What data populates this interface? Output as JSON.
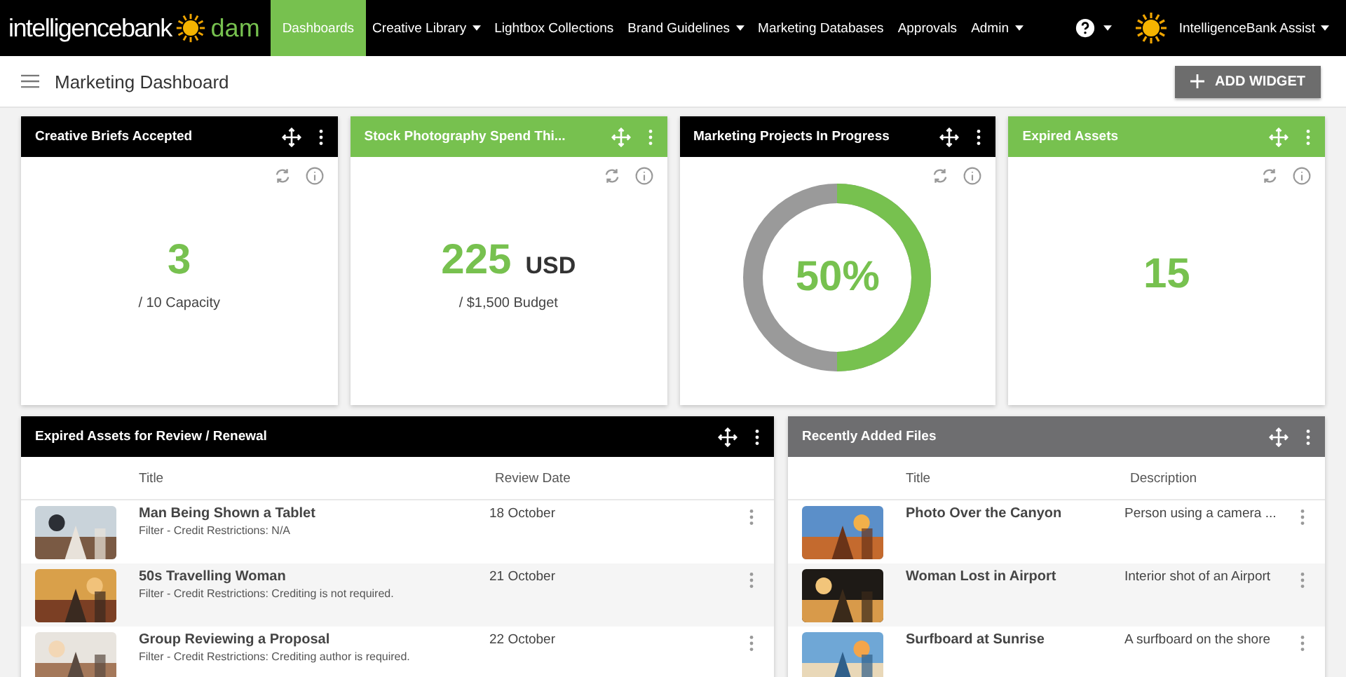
{
  "brand": {
    "name": "intelligencebank",
    "product": "dam"
  },
  "nav": [
    {
      "label": "Dashboards",
      "selected": true,
      "dropdown": false
    },
    {
      "label": "Creative Library",
      "selected": false,
      "dropdown": true
    },
    {
      "label": "Lightbox Collections",
      "selected": false,
      "dropdown": false
    },
    {
      "label": "Brand Guidelines",
      "selected": false,
      "dropdown": true
    },
    {
      "label": "Marketing Databases",
      "selected": false,
      "dropdown": false
    },
    {
      "label": "Approvals",
      "selected": false,
      "dropdown": false
    },
    {
      "label": "Admin",
      "selected": false,
      "dropdown": true
    }
  ],
  "user": {
    "name": "IntelligenceBank Assist"
  },
  "page": {
    "title": "Marketing Dashboard",
    "add_button": "ADD WIDGET"
  },
  "widgets": [
    {
      "title": "Creative Briefs Accepted",
      "color": "#000000",
      "kind": "stat",
      "value": "3",
      "caption": "/ 10 Capacity"
    },
    {
      "title": "Stock Photography Spend Thi...",
      "color": "#77c14f",
      "kind": "stat",
      "value": "225",
      "unit": "USD",
      "caption": "/ $1,500 Budget"
    },
    {
      "title": "Marketing Projects In Progress",
      "color": "#000000",
      "kind": "donut",
      "value": "50%",
      "level": 0.5
    },
    {
      "title": "Expired Assets",
      "color": "#77c14f",
      "kind": "stat",
      "value": "15"
    }
  ],
  "tables": [
    {
      "title": "Expired Assets for Review / Renewal",
      "color": "#000000",
      "columns": [
        "Title",
        "Review Date"
      ],
      "rows": [
        {
          "title": "Man Being Shown a Tablet",
          "subtitle": "Filter - Credit Restrictions: N/A",
          "cell": "18 October"
        },
        {
          "title": "50s Travelling Woman",
          "subtitle": "Filter - Credit Restrictions: Crediting is not required.",
          "cell": "21 October"
        },
        {
          "title": "Group Reviewing a Proposal",
          "subtitle": "Filter - Credit Restrictions: Crediting author is required.",
          "cell": "22 October"
        }
      ]
    },
    {
      "title": "Recently Added Files",
      "color": "#6e6e70",
      "columns": [
        "Title",
        "Description"
      ],
      "rows": [
        {
          "title": "Photo Over the Canyon",
          "cell": "Person using a camera ..."
        },
        {
          "title": "Woman Lost in Airport",
          "cell": "Interior shot of an Airport"
        },
        {
          "title": "Surfboard at Sunrise",
          "cell": "A surfboard on the shore"
        }
      ]
    }
  ]
}
